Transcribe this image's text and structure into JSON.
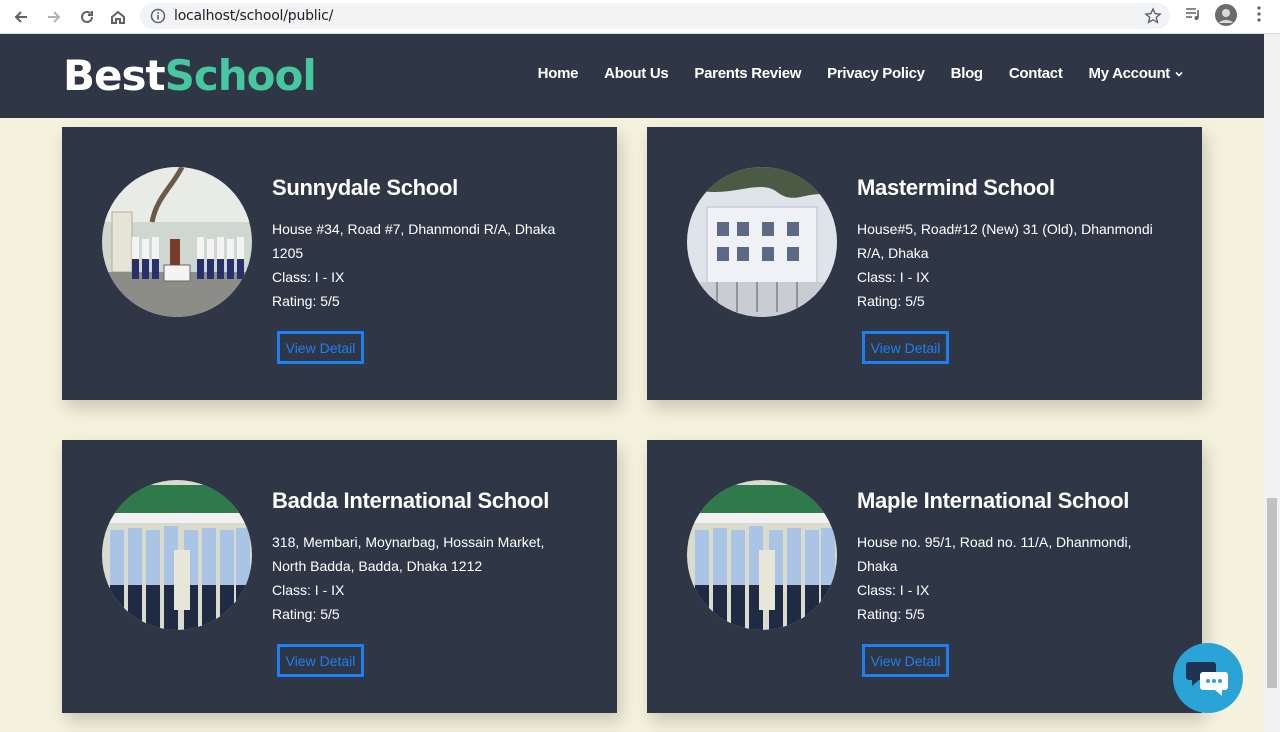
{
  "browser": {
    "url": "localhost/school/public/",
    "icons": [
      "back-icon",
      "forward-icon",
      "reload-icon",
      "home-icon",
      "info-icon",
      "star-icon",
      "media-icon",
      "avatar",
      "more-icon"
    ]
  },
  "header": {
    "logo_part1": "Best",
    "logo_part2": "School",
    "menu": [
      "Home",
      "About Us",
      "Parents Review",
      "Privacy Policy",
      "Blog",
      "Contact",
      "My Account"
    ]
  },
  "colors": {
    "header_bg": "#2f3747",
    "page_bg": "#f4f2dc",
    "accent_green": "#46c7a0",
    "button_blue": "#1e7ff0",
    "chat_blue": "#2aa3d6"
  },
  "schools": [
    {
      "name": "Sunnydale School",
      "address": "House #34, Road #7, Dhanmondi R/A, Dhaka 1205",
      "class": "Class: I - IX",
      "rating": "Rating: 5/5",
      "button": "View Detail"
    },
    {
      "name": "Mastermind School",
      "address": "House#5, Road#12 (New) 31 (Old), Dhanmondi R/A, Dhaka",
      "class": "Class: I - IX",
      "rating": "Rating: 5/5",
      "button": "View Detail"
    },
    {
      "name": "Badda International School",
      "address": "318, Membari, Moynarbag, Hossain Market, North Badda, Badda, Dhaka 1212",
      "class": "Class: I - IX",
      "rating": "Rating: 5/5",
      "button": "View Detail"
    },
    {
      "name": "Maple International School",
      "address": "House no. 95/1, Road no. 11/A, Dhanmondi, Dhaka",
      "class": "Class: I - IX",
      "rating": "Rating: 5/5",
      "button": "View Detail"
    }
  ]
}
